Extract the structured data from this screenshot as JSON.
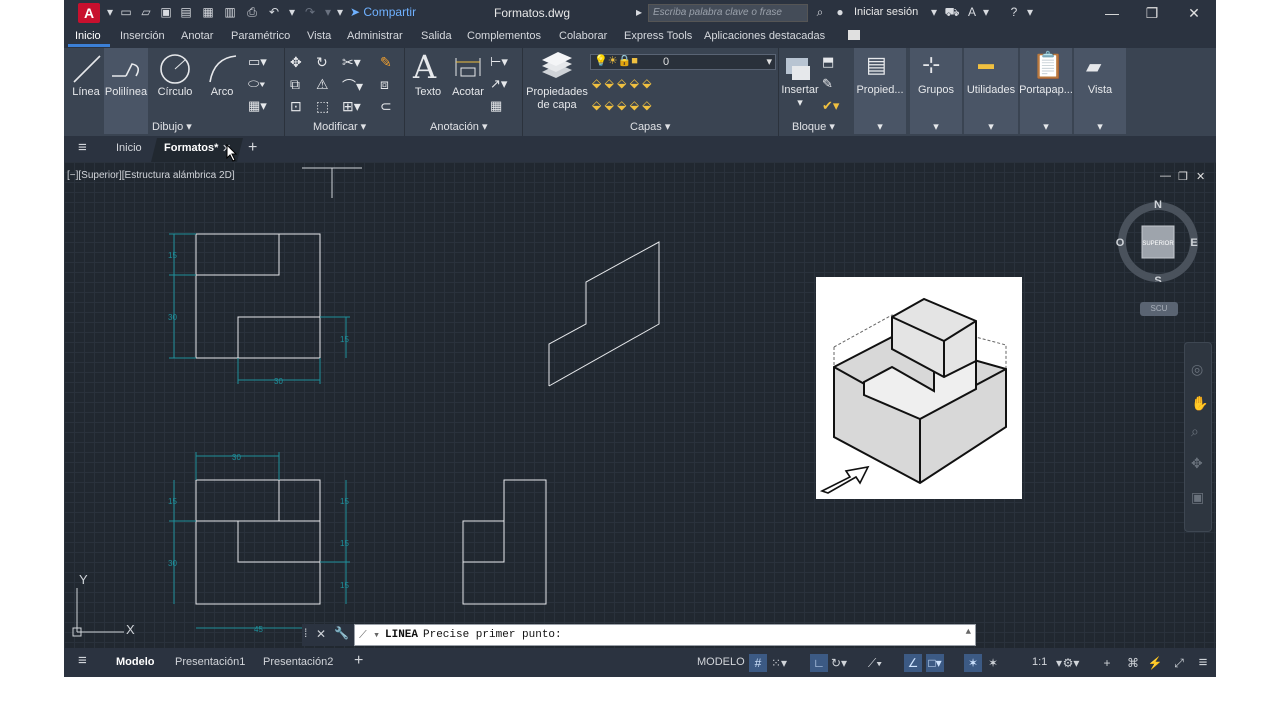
{
  "app": {
    "logo_letter": "A",
    "share_label": "Compartir",
    "title": "Formatos.dwg",
    "search_placeholder": "Escriba palabra clave o frase",
    "login_label": "Iniciar sesión"
  },
  "menu": {
    "items": [
      "Inicio",
      "Inserción",
      "Anotar",
      "Paramétrico",
      "Vista",
      "Administrar",
      "Salida",
      "Complementos",
      "Colaborar",
      "Express Tools",
      "Aplicaciones destacadas"
    ],
    "active": "Inicio"
  },
  "ribbon": {
    "draw_tools": [
      "Línea",
      "Polilínea",
      "Círculo",
      "Arco"
    ],
    "annotate_tools": [
      "Texto",
      "Acotar"
    ],
    "layer_props": "Propiedades de capa",
    "layer_props_l1": "Propiedades",
    "layer_props_l2": "de capa",
    "layer_current": "0",
    "insert_label": "Insertar",
    "big_buttons": [
      "Propied...",
      "Grupos",
      "Utilidades",
      "Portapap...",
      "Vista"
    ],
    "panels": {
      "draw": "Dibujo",
      "modify": "Modificar",
      "annotation": "Anotación",
      "layers": "Capas",
      "block": "Bloque"
    }
  },
  "doc_tabs": {
    "home": "Inicio",
    "current": "Formatos*"
  },
  "viewport": {
    "label": "[−][Superior][Estructura alámbrica 2D]",
    "compass": {
      "n": "N",
      "s": "S",
      "e": "E",
      "w": "O",
      "cube_face": "SUPERIOR"
    },
    "ucs_label": "SCU",
    "dims": [
      "15",
      "30",
      "15",
      "30",
      "30",
      "15",
      "15",
      "15",
      "15",
      "30",
      "45"
    ]
  },
  "command": {
    "name": "LINEA",
    "prompt": "Precise primer punto:"
  },
  "status": {
    "tabs": [
      "Modelo",
      "Presentación1",
      "Presentación2"
    ],
    "active": "Modelo",
    "mode": "MODELO",
    "scale": "1:1"
  },
  "colors": {
    "accent": "#3b7fd6",
    "brand": "#c8102e",
    "cyan_dim": "#1e8f9a",
    "bg": "#212830"
  }
}
